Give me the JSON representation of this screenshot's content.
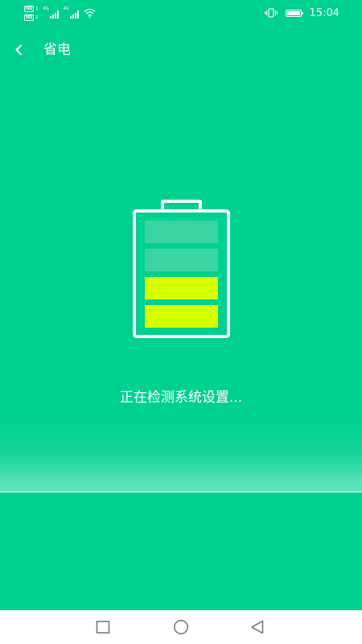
{
  "status_bar": {
    "time": "15:04",
    "sim1_badge": "HD",
    "sim1_num": "1",
    "sim2_badge": "HD",
    "sim2_num": "2",
    "network1": "4G",
    "network2": "4G",
    "icons": [
      "signal-icon",
      "wifi-icon",
      "vibrate-icon",
      "battery-icon"
    ]
  },
  "header": {
    "title": "省电",
    "back_icon": "chevron-left-icon"
  },
  "battery": {
    "levels": [
      {
        "state": "empty",
        "color": "#3bd4a3"
      },
      {
        "state": "empty",
        "color": "#3bd4a3"
      },
      {
        "state": "filled",
        "color": "#d4ff00"
      },
      {
        "state": "filled",
        "color": "#d4ff00"
      }
    ]
  },
  "status": {
    "message": "正在检测系统设置..."
  },
  "nav_bar": {
    "buttons": [
      "recent-apps-icon",
      "home-icon",
      "back-icon"
    ]
  },
  "colors": {
    "background": "#00d18f",
    "accent": "#d4ff00",
    "empty_level": "#3bd4a3",
    "foreground": "#ffffff"
  }
}
